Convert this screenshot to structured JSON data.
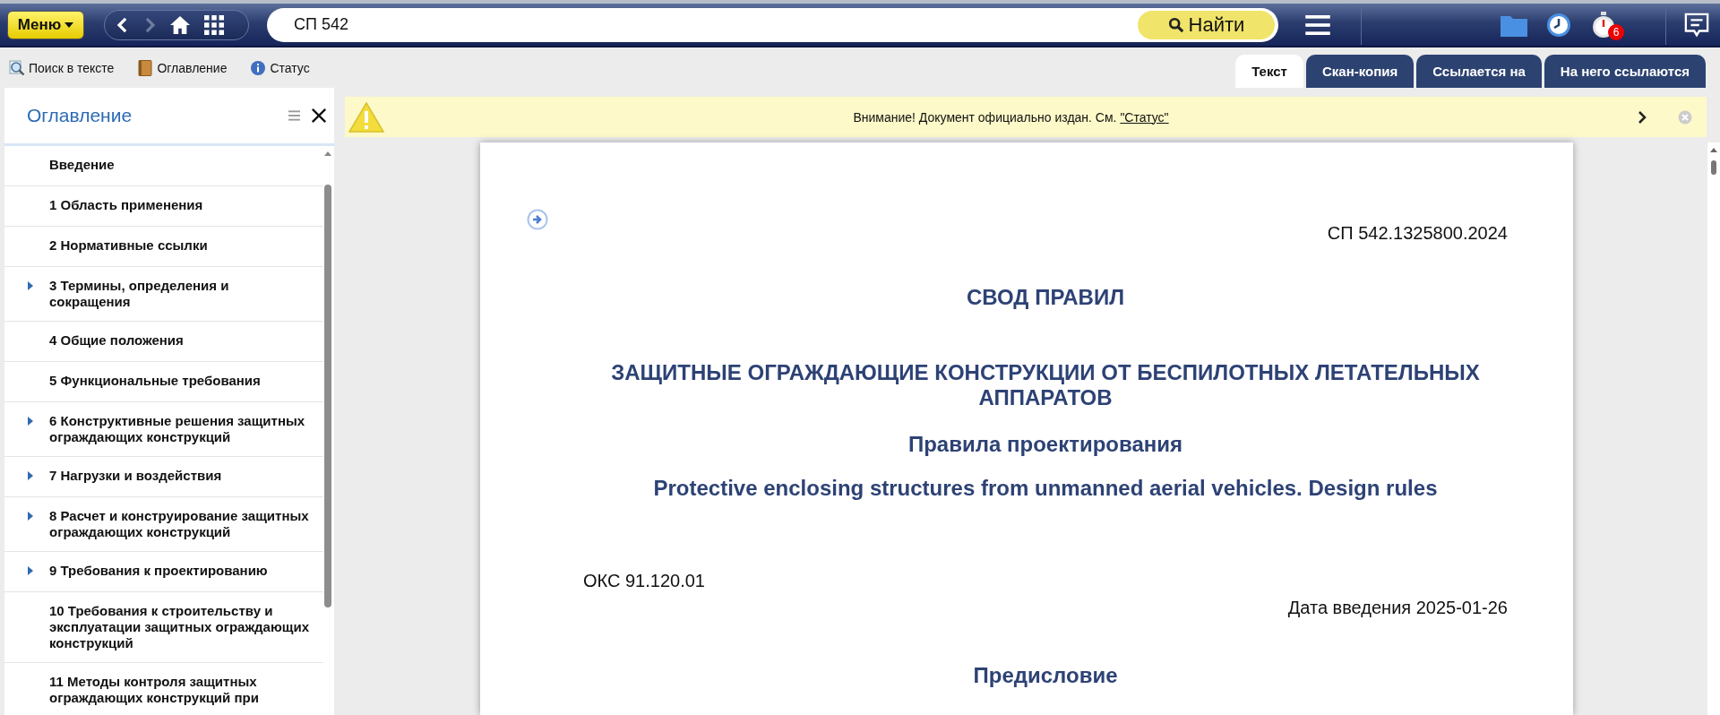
{
  "top_bar": {
    "menu_button": "Меню",
    "search": {
      "value": "СП 542"
    },
    "search_button": "Найти",
    "timer_badge": "6"
  },
  "toolbar": {
    "links": [
      {
        "label": "Поиск в тексте",
        "kind": "search"
      },
      {
        "label": "Оглавление",
        "kind": "book"
      },
      {
        "label": "Статус",
        "kind": "info"
      }
    ]
  },
  "tabs": [
    {
      "label": "Текст",
      "selected": true
    },
    {
      "label": "Скан-копия",
      "selected": false
    },
    {
      "label": "Ссылается на",
      "selected": false
    },
    {
      "label": "На него ссылаются",
      "selected": false
    }
  ],
  "sidebar": {
    "title": "Оглавление",
    "items": [
      {
        "label": "Введение",
        "has_children": false
      },
      {
        "label": "1 Область применения",
        "has_children": false
      },
      {
        "label": "2 Нормативные ссылки",
        "has_children": false
      },
      {
        "label": "3 Термины, определения и сокращения",
        "has_children": true
      },
      {
        "label": "4 Общие положения",
        "has_children": false
      },
      {
        "label": "5 Функциональные требования",
        "has_children": false
      },
      {
        "label": "6 Конструктивные решения защитных ограждающих конструкций",
        "has_children": true
      },
      {
        "label": "7 Нагрузки и воздействия",
        "has_children": true
      },
      {
        "label": "8 Расчет и конструирование защитных ограждающих конструкций",
        "has_children": true
      },
      {
        "label": "9 Требования к проектированию",
        "has_children": true
      },
      {
        "label": "10 Требования к строительству и эксплуатации защитных ограждающих конструкций",
        "has_children": false
      },
      {
        "label": "11 Методы контроля защитных ограждающих конструкций при",
        "has_children": false
      }
    ]
  },
  "notice": {
    "text": "Внимание! Документ официально издан. См. ",
    "link": "\"Статус\""
  },
  "document": {
    "designation": "СП 542.1325800.2024",
    "heading": "СВОД ПРАВИЛ",
    "title": "ЗАЩИТНЫЕ ОГРАЖДАЮЩИЕ КОНСТРУКЦИИ ОТ БЕСПИЛОТНЫХ ЛЕТАТЕЛЬНЫХ АППАРАТОВ",
    "subtitle": "Правила проектирования",
    "title_en": "Protective enclosing structures from unmanned aerial vehicles. Design rules",
    "classification": "ОКС 91.120.01",
    "effective_date": "Дата введения 2025-01-26",
    "section_heading": "Предисловие"
  }
}
